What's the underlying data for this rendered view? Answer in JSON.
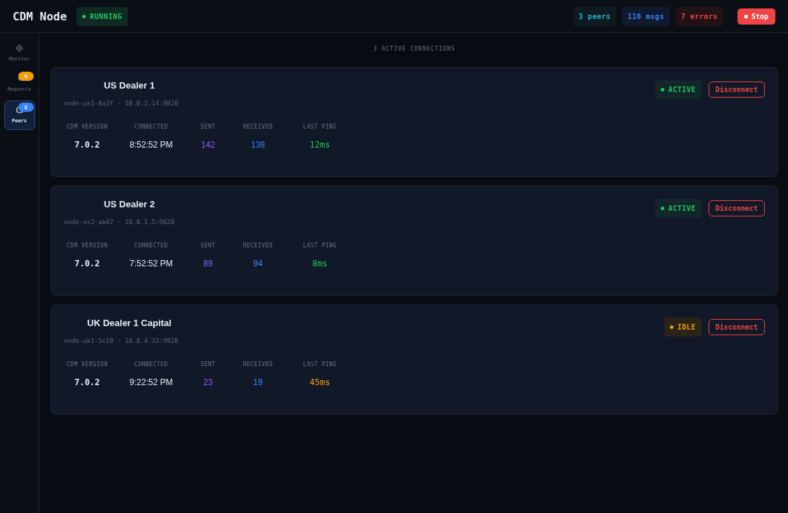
{
  "app": {
    "title": "CDM Node",
    "status": {
      "label": "RUNNING",
      "kind": "running"
    }
  },
  "stats": [
    {
      "kind": "peers",
      "label": "3 peers"
    },
    {
      "kind": "msgs",
      "label": "110 msgs"
    },
    {
      "kind": "errors",
      "label": "7 errors"
    }
  ],
  "stop_button": {
    "icon": "■",
    "label": "Stop"
  },
  "sidebar": {
    "items": [
      {
        "kind": "monitor",
        "label": "Monitor",
        "selected": false
      },
      {
        "kind": "requests",
        "label": "Requests",
        "badge": "5",
        "selected": false
      },
      {
        "kind": "peers",
        "label": "Peers",
        "badge": "3",
        "selected": true
      }
    ]
  },
  "section_heading": "3 ACTIVE CONNECTIONS",
  "peers": [
    {
      "name": "US Dealer 1",
      "address": "node-us1-8a3f · 10.0.2.14:9820",
      "status": {
        "label": "ACTIVE",
        "kind": "active"
      },
      "action": "Disconnect",
      "metrics": [
        {
          "label": "CDM VERSION",
          "value": "7.0.2",
          "kind": "version"
        },
        {
          "label": "CONNECTED",
          "value": "8:52:52 PM",
          "kind": "time"
        },
        {
          "label": "SENT",
          "value": "142",
          "kind": "sent"
        },
        {
          "label": "RECEIVED",
          "value": "138",
          "kind": "received"
        },
        {
          "label": "LAST PING",
          "value": "12ms",
          "kind": "fast"
        }
      ]
    },
    {
      "name": "US Dealer 2",
      "address": "node-us2-ab47 · 10.0.1.5:9820",
      "status": {
        "label": "ACTIVE",
        "kind": "active"
      },
      "action": "Disconnect",
      "metrics": [
        {
          "label": "CDM VERSION",
          "value": "7.0.2",
          "kind": "version"
        },
        {
          "label": "CONNECTED",
          "value": "7:52:52 PM",
          "kind": "time"
        },
        {
          "label": "SENT",
          "value": "89",
          "kind": "sent"
        },
        {
          "label": "RECEIVED",
          "value": "94",
          "kind": "received"
        },
        {
          "label": "LAST PING",
          "value": "8ms",
          "kind": "fast"
        }
      ]
    },
    {
      "name": "UK Dealer 1 Capital",
      "address": "node-uk1-5c18 · 10.0.4.33:9820",
      "status": {
        "label": "IDLE",
        "kind": "idle"
      },
      "action": "Disconnect",
      "metrics": [
        {
          "label": "CDM VERSION",
          "value": "7.0.2",
          "kind": "version"
        },
        {
          "label": "CONNECTED",
          "value": "9:22:52 PM",
          "kind": "time"
        },
        {
          "label": "SENT",
          "value": "23",
          "kind": "sent"
        },
        {
          "label": "RECEIVED",
          "value": "19",
          "kind": "received"
        },
        {
          "label": "LAST PING",
          "value": "45ms",
          "kind": "slow"
        }
      ]
    }
  ]
}
